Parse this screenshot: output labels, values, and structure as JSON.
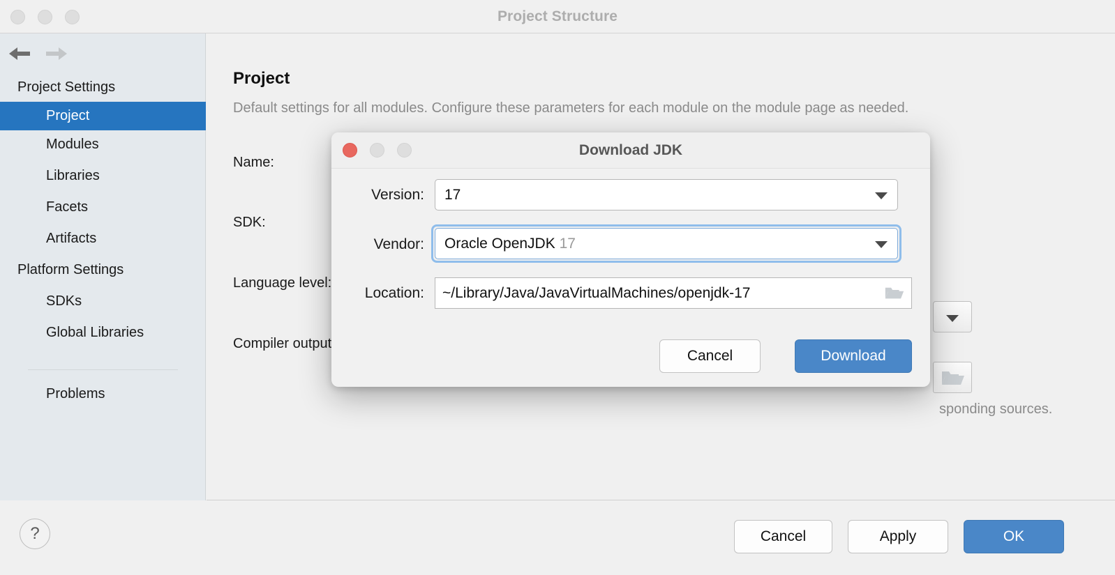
{
  "window": {
    "title": "Project Structure",
    "traffic_lights": [
      "close-button",
      "minimize-button",
      "zoom-button"
    ]
  },
  "sidebar": {
    "nav": {
      "back_icon": "arrow-left-icon",
      "forward_icon": "arrow-right-icon",
      "back_enabled": true,
      "forward_enabled": false
    },
    "items": [
      {
        "label": "Project Settings",
        "type": "group",
        "selected": false
      },
      {
        "label": "Project",
        "type": "item",
        "selected": true
      },
      {
        "label": "Modules",
        "type": "item",
        "selected": false
      },
      {
        "label": "Libraries",
        "type": "item",
        "selected": false
      },
      {
        "label": "Facets",
        "type": "item",
        "selected": false
      },
      {
        "label": "Artifacts",
        "type": "item",
        "selected": false
      },
      {
        "label": "Platform Settings",
        "type": "group",
        "selected": false
      },
      {
        "label": "SDKs",
        "type": "item",
        "selected": false
      },
      {
        "label": "Global Libraries",
        "type": "item",
        "selected": false
      },
      {
        "label": "Problems",
        "type": "item",
        "selected": false
      }
    ],
    "selected_color": "#2675bf",
    "background_color": "#e4e9ed"
  },
  "content": {
    "title": "Project",
    "subtitle": "Default settings for all modules. Configure these parameters for each module on the module page as needed.",
    "fields": [
      {
        "label": "Name:"
      },
      {
        "label": "SDK:"
      },
      {
        "label": "Language level:"
      },
      {
        "label": "Compiler output:"
      }
    ],
    "occluded_labels": {
      "language_level_visible": "Language le",
      "compiler_output_visible": "Compiler ou"
    },
    "hint_text": "sponding sources.",
    "sdk_dropdown_icon": "chevron-down-icon",
    "compiler_browse_icon": "folder-icon"
  },
  "bottom_bar": {
    "help_label": "?",
    "buttons": [
      {
        "label": "Cancel",
        "style": "secondary"
      },
      {
        "label": "Apply",
        "style": "secondary"
      },
      {
        "label": "OK",
        "style": "primary"
      }
    ],
    "primary_color": "#4a87c8"
  },
  "dialog": {
    "title": "Download JDK",
    "traffic_lights": [
      "close-button",
      "minimize-button",
      "zoom-button"
    ],
    "close_color": "#e8685f",
    "focus_ring_color": "#8fbdeb",
    "fields": {
      "version": {
        "label": "Version:",
        "value": "17",
        "caret_icon": "chevron-down-icon",
        "focused": false
      },
      "vendor": {
        "label": "Vendor:",
        "value": "Oracle OpenJDK",
        "value_suffix": "17",
        "caret_icon": "chevron-down-icon",
        "focused": true
      },
      "location": {
        "label": "Location:",
        "value": "~/Library/Java/JavaVirtualMachines/openjdk-17",
        "browse_icon": "folder-icon"
      }
    },
    "buttons": [
      {
        "label": "Cancel",
        "style": "secondary"
      },
      {
        "label": "Download",
        "style": "primary"
      }
    ]
  }
}
